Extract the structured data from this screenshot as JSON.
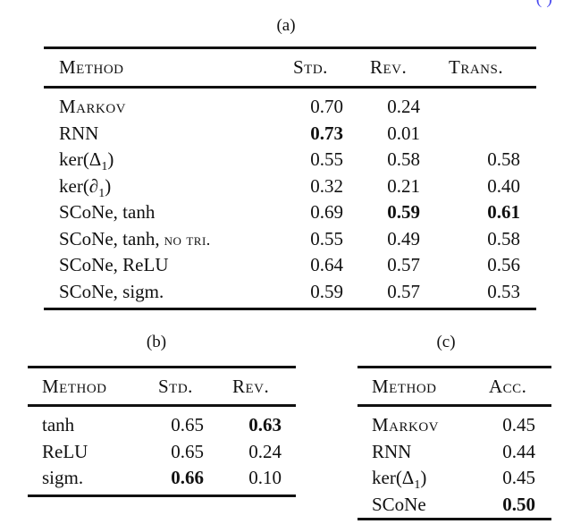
{
  "corner_link": "( )",
  "table_a": {
    "caption": "(a)",
    "headers": [
      "Method",
      "Std.",
      "Rev.",
      "Trans."
    ],
    "rows": [
      {
        "method": "Markov",
        "method_smallcaps": true,
        "std": "0.70",
        "rev": "0.24",
        "trans": "",
        "bold": []
      },
      {
        "method": "RNN",
        "std": "0.73",
        "rev": "0.01",
        "trans": "",
        "bold": [
          "std"
        ]
      },
      {
        "method": "ker(Δ",
        "sub": "1",
        "close": ")",
        "std": "0.55",
        "rev": "0.58",
        "trans": "0.58",
        "bold": []
      },
      {
        "method": "ker(∂",
        "sub": "1",
        "close": ")",
        "std": "0.32",
        "rev": "0.21",
        "trans": "0.40",
        "bold": []
      },
      {
        "method": "SCoNe, tanh",
        "std": "0.69",
        "rev": "0.59",
        "trans": "0.61",
        "bold": [
          "rev",
          "trans"
        ]
      },
      {
        "method": "SCoNe, tanh,",
        "suffix_smallcaps": "no tri.",
        "std": "0.55",
        "rev": "0.49",
        "trans": "0.58",
        "bold": []
      },
      {
        "method": "SCoNe, ReLU",
        "std": "0.64",
        "rev": "0.57",
        "trans": "0.56",
        "bold": []
      },
      {
        "method": "SCoNe, sigm.",
        "std": "0.59",
        "rev": "0.57",
        "trans": "0.53",
        "bold": []
      }
    ]
  },
  "table_b": {
    "caption": "(b)",
    "headers": [
      "Method",
      "Std.",
      "Rev."
    ],
    "rows": [
      {
        "method": "tanh",
        "std": "0.65",
        "rev": "0.63",
        "bold": [
          "rev"
        ]
      },
      {
        "method": "ReLU",
        "std": "0.65",
        "rev": "0.24",
        "bold": []
      },
      {
        "method": "sigm.",
        "std": "0.66",
        "rev": "0.10",
        "bold": [
          "std"
        ]
      }
    ]
  },
  "table_c": {
    "caption": "(c)",
    "headers": [
      "Method",
      "Acc."
    ],
    "rows": [
      {
        "method": "Markov",
        "method_smallcaps": true,
        "acc": "0.45",
        "bold": []
      },
      {
        "method": "RNN",
        "acc": "0.44",
        "bold": []
      },
      {
        "method": "ker(Δ",
        "sub": "1",
        "close": ")",
        "acc": "0.45",
        "bold": []
      },
      {
        "method": "SCoNe",
        "acc": "0.50",
        "bold": [
          "acc"
        ]
      }
    ]
  }
}
